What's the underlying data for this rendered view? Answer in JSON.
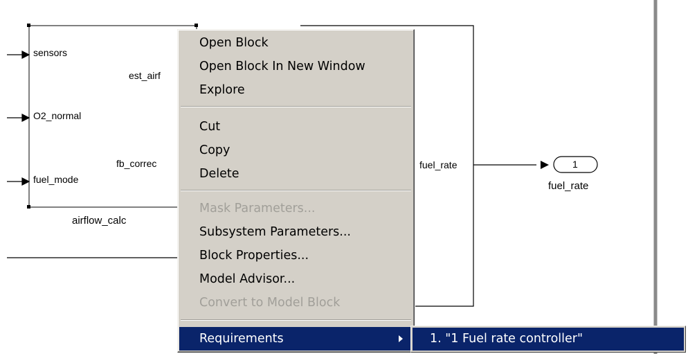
{
  "diagram": {
    "subsystem": {
      "name": "airflow_calc",
      "inputs": [
        "sensors",
        "O2_normal",
        "fuel_mode"
      ],
      "outputs": [
        "est_airf",
        "fb_correc"
      ]
    },
    "signal_label": "fuel_rate",
    "outport": {
      "number": "1",
      "name": "fuel_rate"
    }
  },
  "context_menu": {
    "items": [
      {
        "label": "Open Block",
        "enabled": true
      },
      {
        "label": "Open Block In New Window",
        "enabled": true
      },
      {
        "label": "Explore",
        "enabled": true
      },
      {
        "label": "Cut",
        "enabled": true
      },
      {
        "label": "Copy",
        "enabled": true
      },
      {
        "label": "Delete",
        "enabled": true
      },
      {
        "label": "Mask Parameters...",
        "enabled": false
      },
      {
        "label": "Subsystem Parameters...",
        "enabled": true
      },
      {
        "label": "Block Properties...",
        "enabled": true
      },
      {
        "label": "Model Advisor...",
        "enabled": true
      },
      {
        "label": "Convert to Model Block",
        "enabled": false
      },
      {
        "label": "Requirements",
        "enabled": true,
        "highlighted": true,
        "has_submenu": true
      }
    ]
  },
  "submenu": {
    "items": [
      {
        "label": "1. \"1 Fuel rate controller\"",
        "highlighted": true
      }
    ]
  },
  "colors": {
    "menu_bg": "#d4d0c8",
    "highlight": "#0a246a",
    "disabled_text": "#a19f99"
  }
}
